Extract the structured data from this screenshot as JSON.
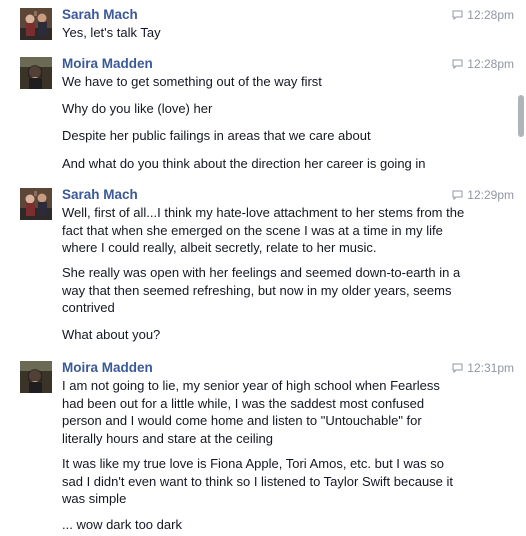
{
  "messages": [
    {
      "sender": "Sarah Mach",
      "time": "12:28pm",
      "avatar_icon": "profile-photo-sarah",
      "lines": [
        "Yes, let's talk Tay"
      ]
    },
    {
      "sender": "Moira Madden",
      "time": "12:28pm",
      "avatar_icon": "profile-photo-moira",
      "lines": [
        "We have to get something out of the way first",
        "Why do you like (love) her",
        "Despite her public failings in areas that we care about",
        "And what do you think about the direction her career is going in"
      ]
    },
    {
      "sender": "Sarah Mach",
      "time": "12:29pm",
      "avatar_icon": "profile-photo-sarah",
      "lines": [
        "Well, first of all...I think my hate-love attachment to her stems from the\nfact that when she emerged on the scene I was at a time in my life\nwhere I could really, albeit secretly, relate to her music.",
        "She really was open with her feelings and seemed down-to-earth in a\nway that then seemed refreshing, but now in my older years, seems\ncontrived",
        "What about you?"
      ]
    },
    {
      "sender": "Moira Madden",
      "time": "12:31pm",
      "avatar_icon": "profile-photo-moira",
      "lines": [
        "I am not going to lie, my senior year of high school when Fearless\nhad been out for a little while, I was the saddest most confused\nperson and I would come home and listen to \"Untouchable\" for\nliterally hours and stare at the ceiling",
        "It was like my true love is Fiona Apple, Tori Amos, etc. but I was so\nsad I didn't even want to think so I listened to Taylor Swift because it\nwas simple",
        "... wow dark too dark"
      ]
    }
  ],
  "icons": {
    "timestamp": "speech-bubble-icon"
  },
  "colors": {
    "sender_name": "#3b5998",
    "message_text": "#141823",
    "timestamp": "#9197a3",
    "scrollbar_thumb": "#b0b3b8"
  }
}
